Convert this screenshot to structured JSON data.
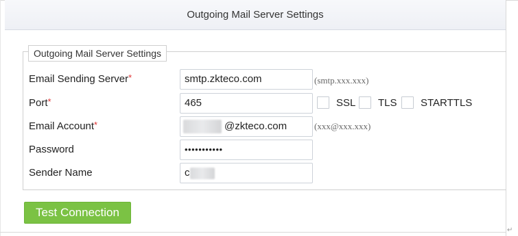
{
  "window": {
    "title": "Outgoing Mail Server Settings"
  },
  "fieldset": {
    "legend": "Outgoing Mail Server Settings"
  },
  "form": {
    "server": {
      "label": "Email Sending Server",
      "required": "*",
      "value": "smtp.zkteco.com",
      "hint": "(smtp.xxx.xxx)"
    },
    "port": {
      "label": "Port",
      "required": "*",
      "value": "465"
    },
    "account": {
      "label": "Email Account",
      "required": "*",
      "value": "@zkteco.com",
      "hint": "(xxx@xxx.xxx)"
    },
    "password": {
      "label": "Password",
      "value": "•••••••••••"
    },
    "sender": {
      "label": "Sender Name",
      "value": "c"
    }
  },
  "security": {
    "ssl": {
      "label": "SSL",
      "checked": false
    },
    "tls": {
      "label": "TLS",
      "checked": false
    },
    "starttls": {
      "label": "STARTTLS",
      "checked": false
    }
  },
  "actions": {
    "test_connection": "Test Connection"
  },
  "colors": {
    "primary_button": "#7bc244",
    "required_marker": "#e03333"
  }
}
